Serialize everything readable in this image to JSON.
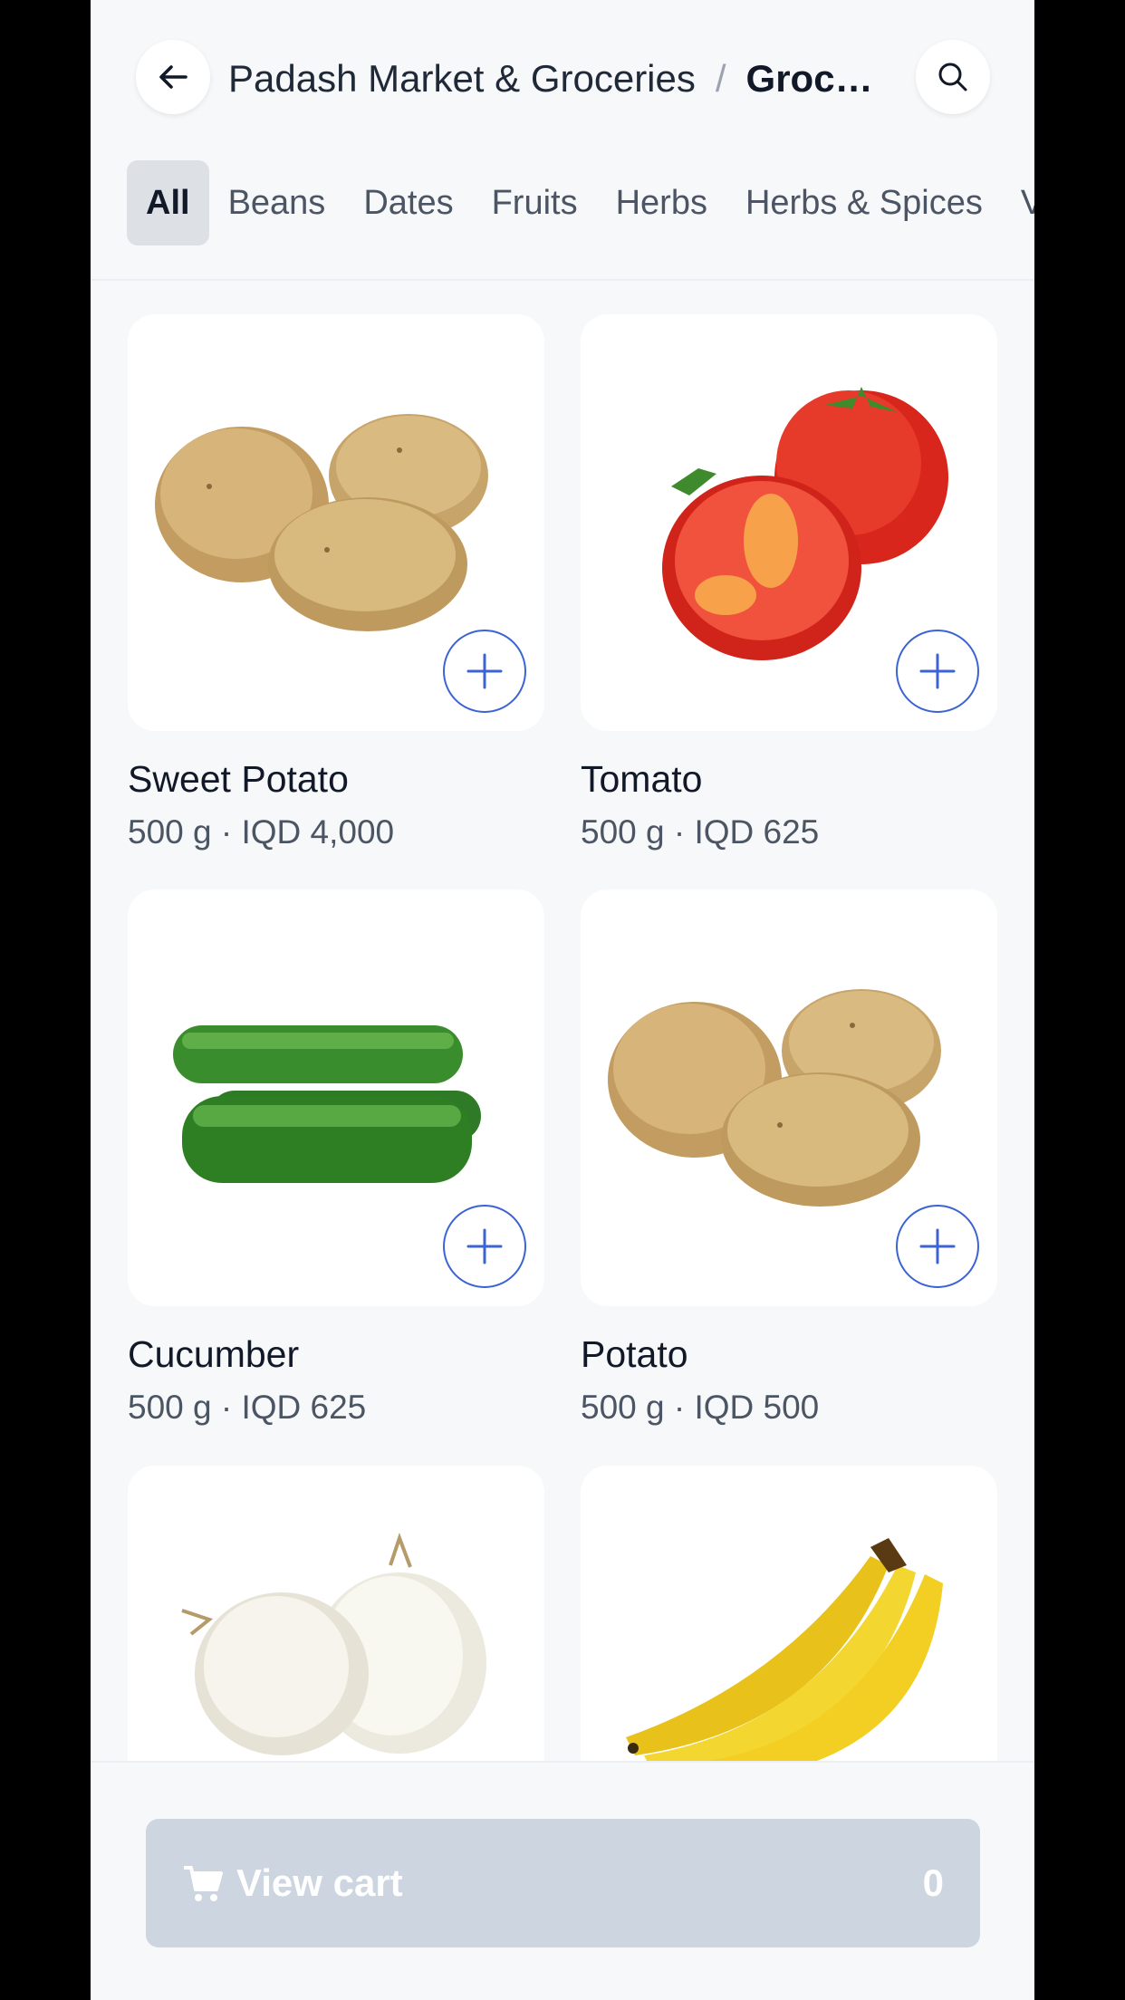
{
  "header": {
    "store_name": "Padash Market & Groceries",
    "separator": "/",
    "category": "Groce…",
    "back_icon": "arrow-left-icon",
    "search_icon": "search-icon"
  },
  "tabs": [
    {
      "label": "All",
      "active": true
    },
    {
      "label": "Beans"
    },
    {
      "label": "Dates"
    },
    {
      "label": "Fruits"
    },
    {
      "label": "Herbs"
    },
    {
      "label": "Herbs & Spices"
    },
    {
      "label": "V"
    }
  ],
  "products": [
    {
      "name": "Sweet Potato",
      "meta": "500 g · IQD 4,000",
      "image": "potatoes"
    },
    {
      "name": "Tomato",
      "meta": "500 g · IQD 625",
      "image": "tomatoes"
    },
    {
      "name": "Cucumber",
      "meta": "500 g · IQD 625",
      "image": "cucumbers"
    },
    {
      "name": "Potato",
      "meta": "500 g · IQD 500",
      "image": "potatoes"
    },
    {
      "name": "",
      "meta": "",
      "image": "onions"
    },
    {
      "name": "",
      "meta": "",
      "image": "bananas"
    }
  ],
  "cart": {
    "label": "View cart",
    "count": "0",
    "icon": "cart-icon"
  },
  "colors": {
    "accent": "#3b63d4",
    "cart_button": "#cdd5e0",
    "background": "#f7f8fa"
  }
}
